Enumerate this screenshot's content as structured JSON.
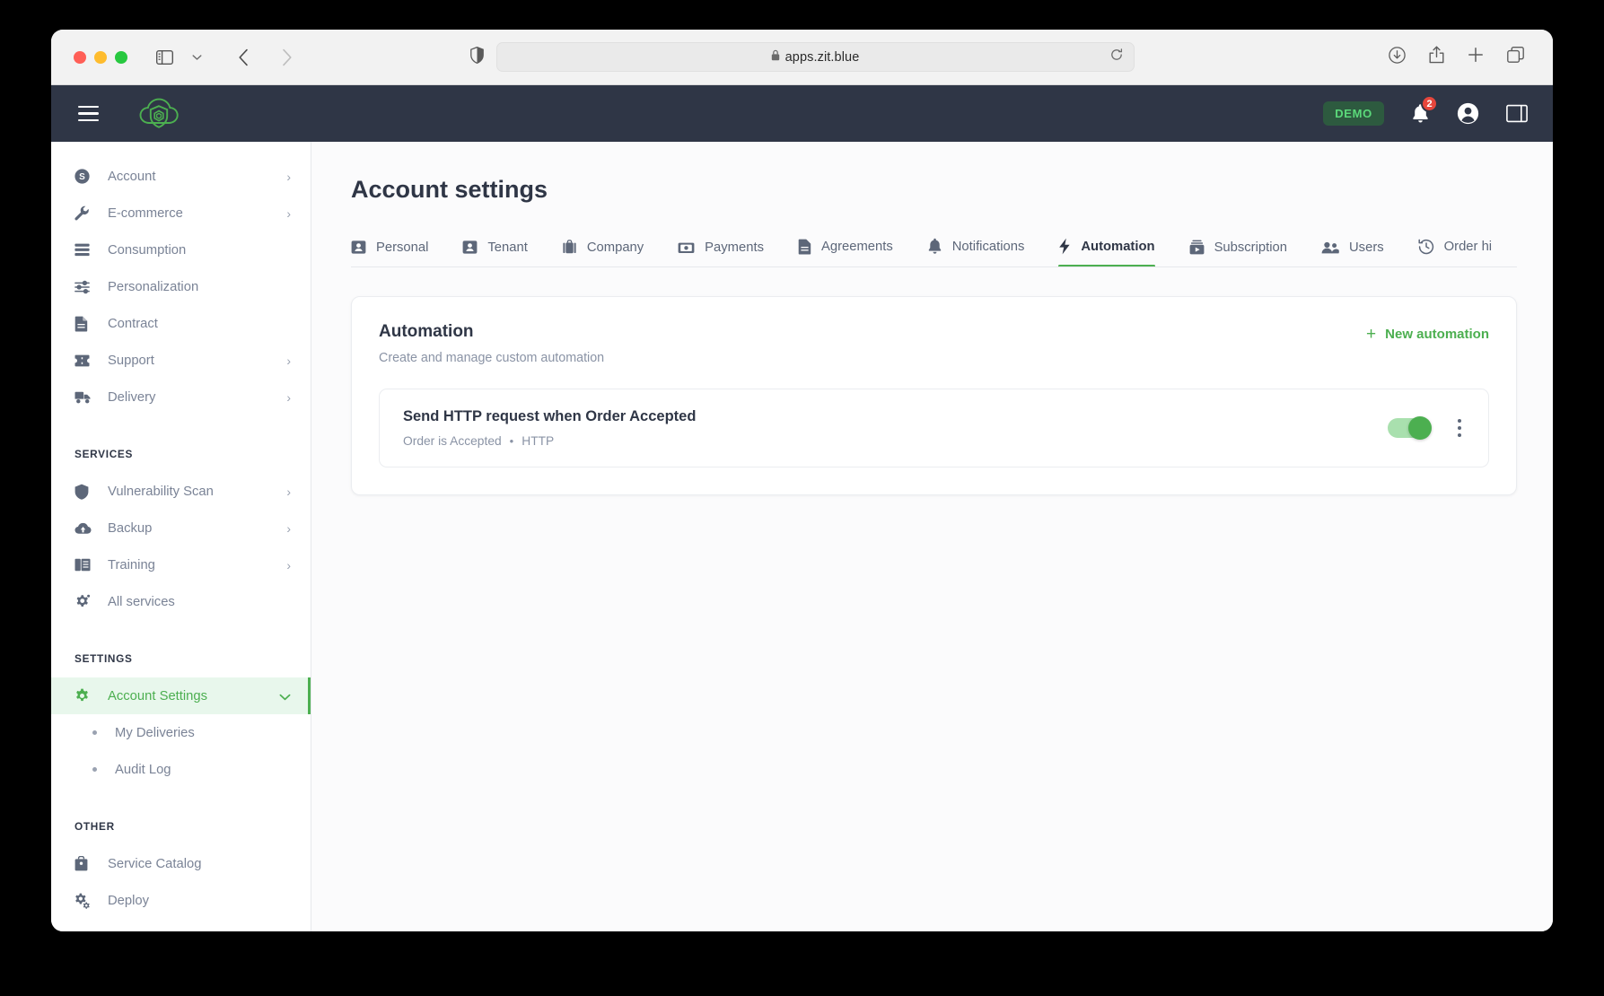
{
  "browser": {
    "url": "apps.zit.blue",
    "lock_icon": "lock-icon",
    "shield_icon": "privacy-shield-icon",
    "reload_icon": "reload-icon",
    "sidebar_toggle_icon": "sidebar-toggle-icon",
    "back_arrow": "‹",
    "forward_arrow": "›",
    "chevron_down": "⌄",
    "right_icons": [
      "downloads-icon",
      "share-icon",
      "new-tab-icon",
      "tab-overview-icon"
    ]
  },
  "header": {
    "menu_icon": "hamburger-menu-icon",
    "logo_icon": "cloud-shield-logo",
    "demo_badge": "DEMO",
    "notification_icon": "bell-icon",
    "notification_count": "2",
    "account_icon": "account-circle-icon",
    "panel_icon": "right-panel-icon"
  },
  "sidebar": {
    "main_items": [
      {
        "label": "Account",
        "icon": "dollar-circle-icon",
        "chevron": "›"
      },
      {
        "label": "E-commerce",
        "icon": "wrench-icon",
        "chevron": "›"
      },
      {
        "label": "Consumption",
        "icon": "list-icon",
        "chevron": ""
      },
      {
        "label": "Personalization",
        "icon": "sliders-icon",
        "chevron": ""
      },
      {
        "label": "Contract",
        "icon": "document-icon",
        "chevron": ""
      },
      {
        "label": "Support",
        "icon": "ticket-icon",
        "chevron": "›"
      },
      {
        "label": "Delivery",
        "icon": "truck-icon",
        "chevron": "›"
      }
    ],
    "services_label": "SERVICES",
    "services_items": [
      {
        "label": "Vulnerability Scan",
        "icon": "shield-icon",
        "chevron": "›"
      },
      {
        "label": "Backup",
        "icon": "cloud-up-icon",
        "chevron": "›"
      },
      {
        "label": "Training",
        "icon": "book-icon",
        "chevron": "›"
      },
      {
        "label": "All services",
        "icon": "gear-sparkle-icon",
        "chevron": ""
      }
    ],
    "settings_label": "SETTINGS",
    "settings_active": {
      "label": "Account Settings",
      "icon": "gear-icon",
      "chevron": "⌄"
    },
    "settings_sub_items": [
      {
        "label": "My Deliveries"
      },
      {
        "label": "Audit Log"
      }
    ],
    "other_label": "OTHER",
    "other_items": [
      {
        "label": "Service Catalog",
        "icon": "briefcase-icon"
      },
      {
        "label": "Deploy",
        "icon": "gears-icon"
      }
    ]
  },
  "main": {
    "page_title": "Account settings",
    "tabs": [
      {
        "label": "Personal",
        "icon": "id-card-icon",
        "active": false
      },
      {
        "label": "Tenant",
        "icon": "id-card-icon",
        "active": false
      },
      {
        "label": "Company",
        "icon": "briefcase-icon",
        "active": false
      },
      {
        "label": "Payments",
        "icon": "money-icon",
        "active": false
      },
      {
        "label": "Agreements",
        "icon": "document-icon",
        "active": false
      },
      {
        "label": "Notifications",
        "icon": "bell-icon",
        "active": false
      },
      {
        "label": "Automation",
        "icon": "lightning-bolt-icon",
        "active": true
      },
      {
        "label": "Subscription",
        "icon": "subscription-icon",
        "active": false
      },
      {
        "label": "Users",
        "icon": "users-icon",
        "active": false
      },
      {
        "label": "Order hi",
        "icon": "history-icon",
        "active": false
      }
    ],
    "card": {
      "title": "Automation",
      "subtitle": "Create and manage custom automation",
      "new_button": "New automation",
      "new_button_plus": "+",
      "rows": [
        {
          "title": "Send HTTP request when Order Accepted",
          "trigger": "Order is Accepted",
          "separator": "•",
          "action": "HTTP",
          "enabled": true
        }
      ]
    }
  },
  "colors": {
    "accent_green": "#4caf50",
    "header_dark": "#2f3646",
    "badge_red": "#e6463c"
  }
}
